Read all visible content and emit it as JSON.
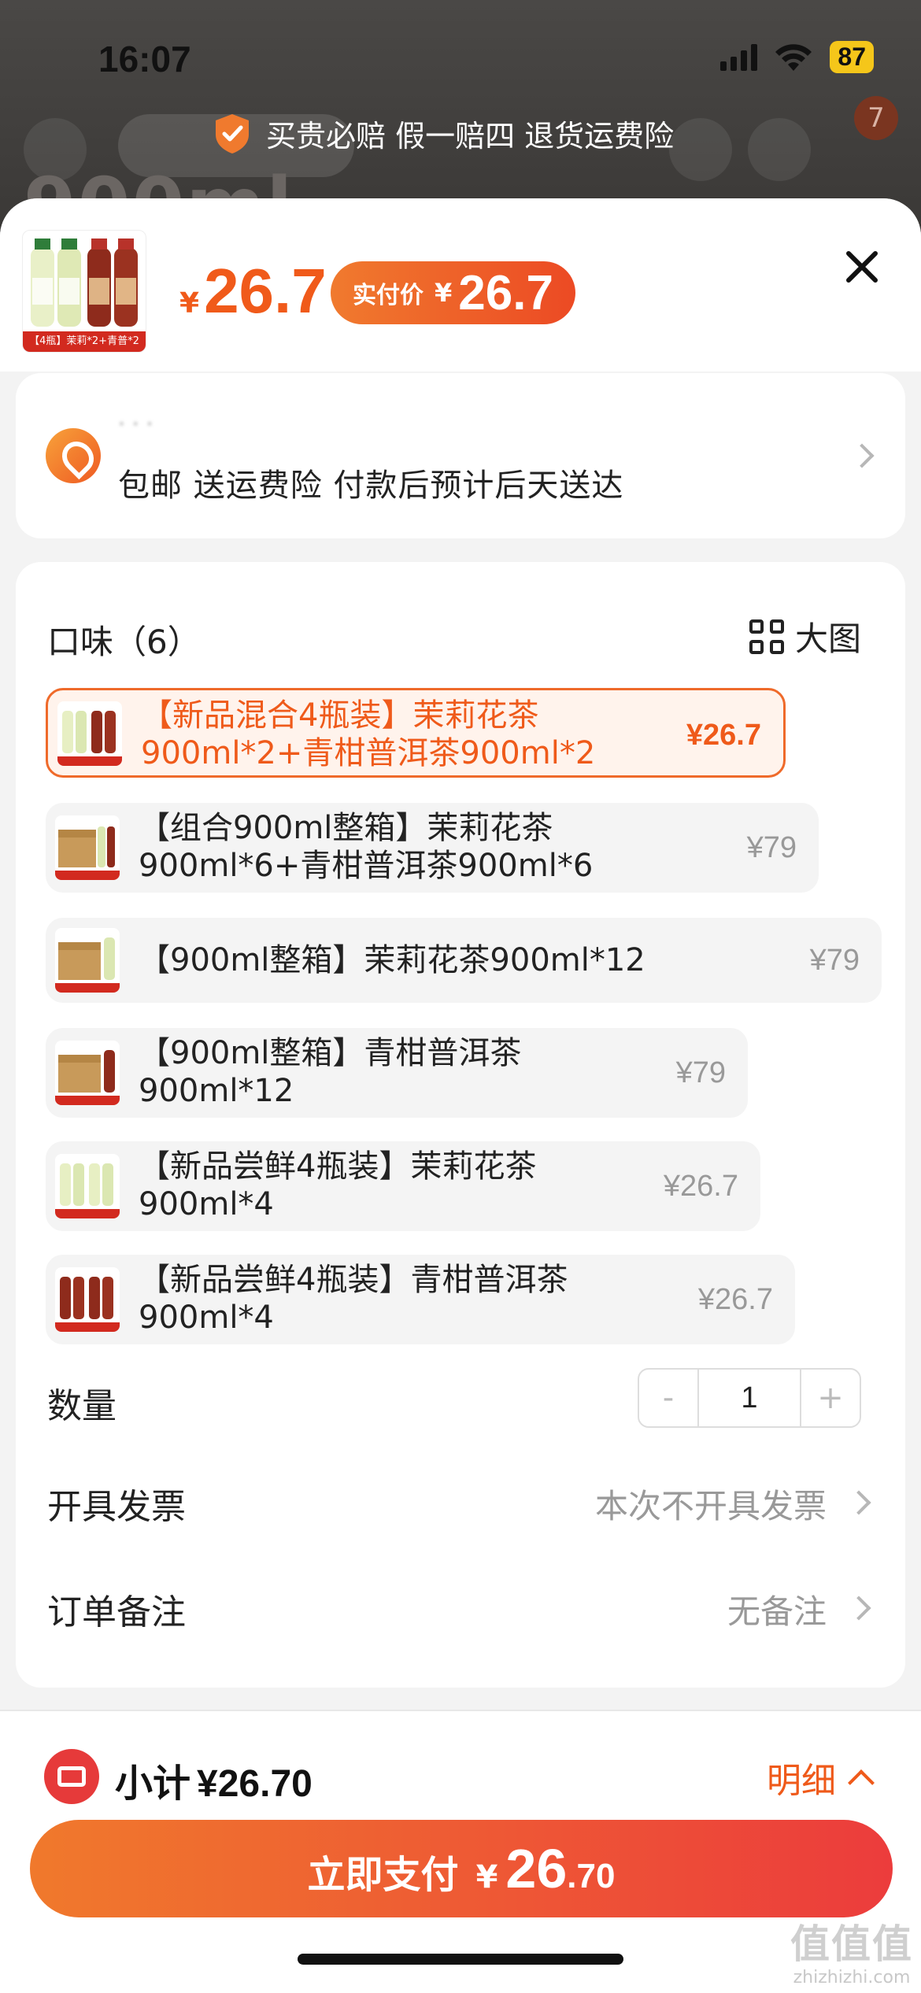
{
  "status_bar": {
    "time": "16:07",
    "battery": "87"
  },
  "background": {
    "badge_count": "7"
  },
  "banner": {
    "guarantee_text": "买贵必赔 假一赔四 退货运费险"
  },
  "header": {
    "thumb_label": "【4瓶】茉莉*2+青普*2",
    "price_currency": "¥",
    "price": "26.7",
    "paid_label": "实付价",
    "paid_currency": "¥",
    "paid_price": "26.7"
  },
  "address": {
    "shipping_info": "包邮  送运费险  付款后预计后天送达"
  },
  "flavor": {
    "title": "口味（6）",
    "bigview_label": "大图",
    "options": [
      {
        "line1": "【新品混合4瓶装】茉莉花茶",
        "line2": "900ml*2+青柑普洱茶900ml*2",
        "price": "¥26.7"
      },
      {
        "line1": "【组合900ml整箱】茉莉花茶",
        "line2": "900ml*6+青柑普洱茶900ml*6",
        "price": "¥79"
      },
      {
        "line1": "【900ml整箱】茉莉花茶900ml*12",
        "line2": "",
        "price": "¥79"
      },
      {
        "line1": "【900ml整箱】青柑普洱茶",
        "line2": "900ml*12",
        "price": "¥79"
      },
      {
        "line1": "【新品尝鲜4瓶装】茉莉花茶",
        "line2": "900ml*4",
        "price": "¥26.7"
      },
      {
        "line1": "【新品尝鲜4瓶装】青柑普洱茶",
        "line2": "900ml*4",
        "price": "¥26.7"
      }
    ],
    "selected_index": 0
  },
  "quantity": {
    "label": "数量",
    "minus": "-",
    "value": "1",
    "plus": "+"
  },
  "invoice": {
    "label": "开具发票",
    "value": "本次不开具发票"
  },
  "remark": {
    "label": "订单备注",
    "value": "无备注"
  },
  "footer": {
    "subtotal_label": "小计",
    "subtotal_amount": "¥26.70",
    "detail_label": "明细",
    "pay_label": "立即支付",
    "pay_currency": "¥",
    "pay_int": "26",
    "pay_dec": ".70"
  },
  "watermark": {
    "big": "值值值",
    "small": "zhizhizhi.com"
  },
  "colors": {
    "accent": "#ef5a1a",
    "pay_gradient_start": "#f0792c",
    "pay_gradient_end": "#ec3c3c"
  }
}
